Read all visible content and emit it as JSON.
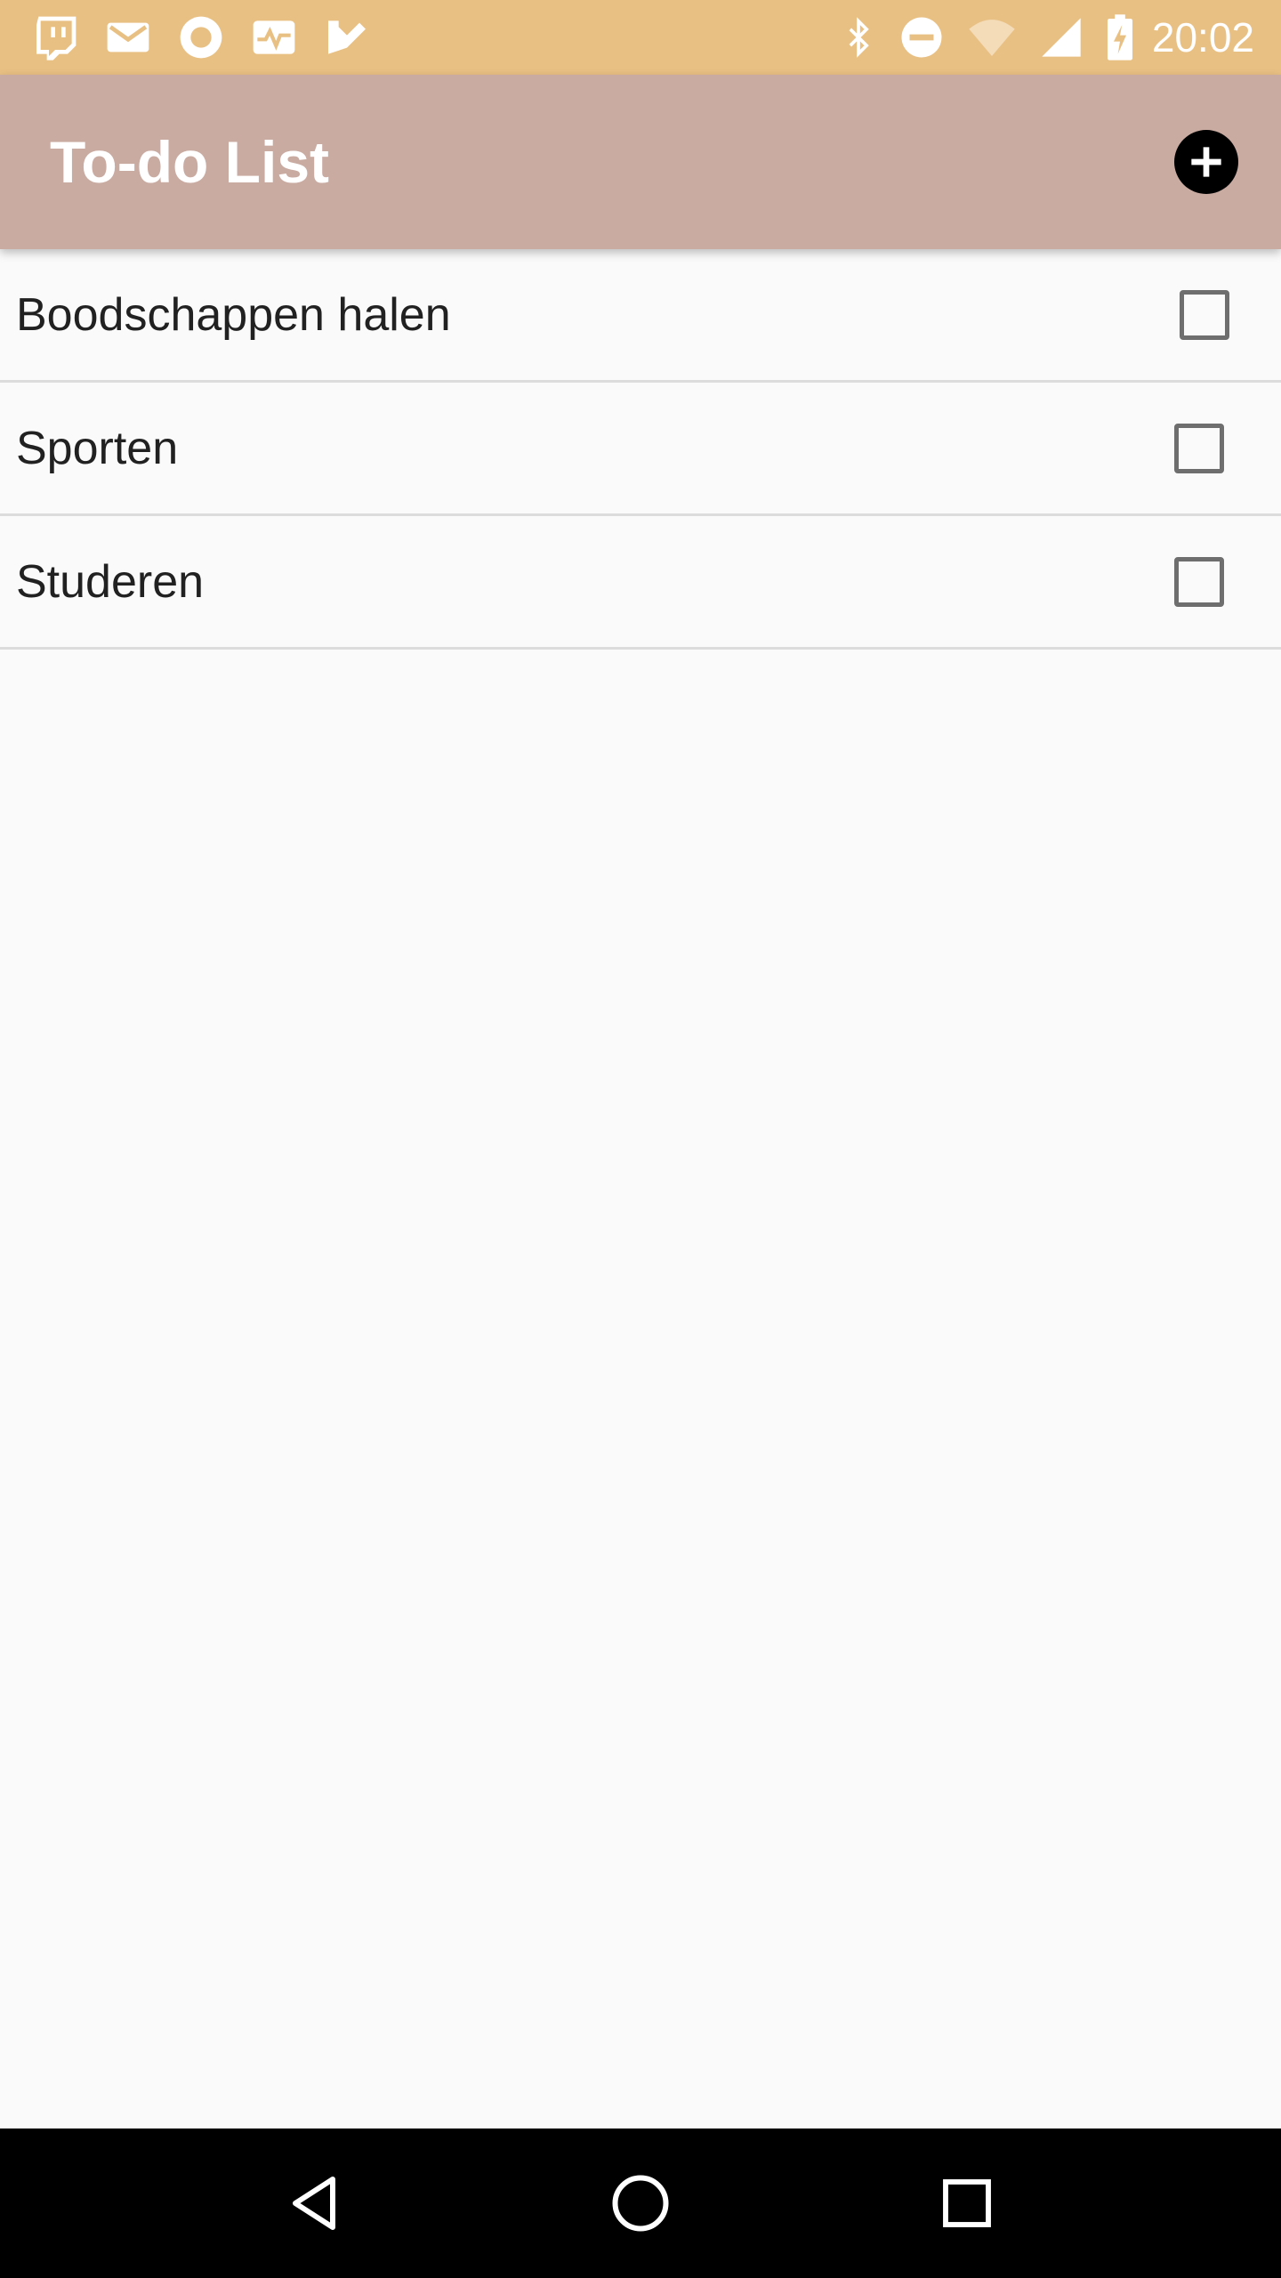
{
  "status_bar": {
    "time": "20:02",
    "background": "#e9c084",
    "left_icons": [
      "twitch-icon",
      "gmail-icon",
      "circle-app-icon",
      "pulse-icon",
      "tasks-check-icon"
    ],
    "right_icons": [
      "bluetooth-icon",
      "do-not-disturb-icon",
      "wifi-icon",
      "cellular-signal-icon",
      "battery-charging-icon"
    ]
  },
  "app_bar": {
    "title": "To-do List",
    "background": "#caaba2",
    "add_icon": "plus-circle-icon"
  },
  "todo": {
    "items": [
      {
        "label": "Boodschappen halen",
        "checked": false
      },
      {
        "label": "Sporten",
        "checked": false
      },
      {
        "label": "Studeren",
        "checked": false
      }
    ]
  },
  "nav_bar": {
    "buttons": [
      "back-icon",
      "home-icon",
      "recents-icon"
    ]
  }
}
